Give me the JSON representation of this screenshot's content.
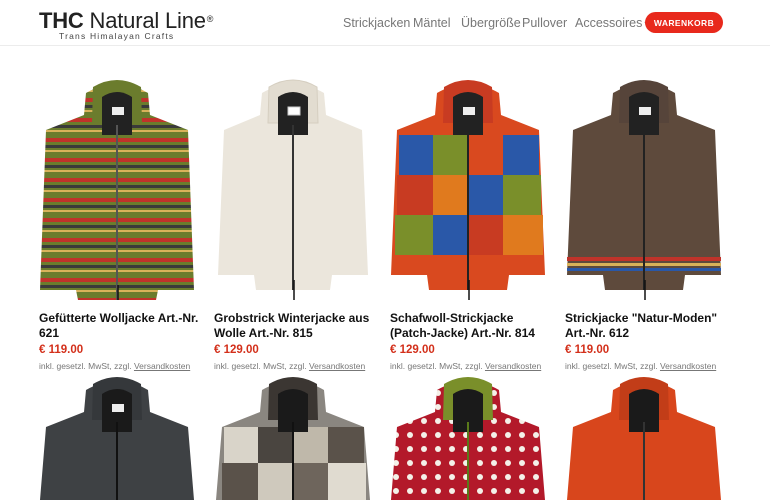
{
  "header": {
    "logo_bold": "THC",
    "logo_light": "Natural Line",
    "logo_reg": "®",
    "logo_tagline": "Trans Himalayan Crafts",
    "nav": [
      {
        "label": "Strickjacken"
      },
      {
        "label": "Mäntel"
      },
      {
        "label": "Übergröße"
      },
      {
        "label": "Pullover"
      },
      {
        "label": "Accessoires"
      }
    ],
    "cart_label": "WARENKORB"
  },
  "products": [
    {
      "title": "Gefütterte Wolljacke Art.-Nr. 621",
      "price": "€ 119.00",
      "tax_text": "inkl. gesetzl. MwSt, zzgl.",
      "shipping_link": "Versandkosten"
    },
    {
      "title": "Grobstrick Winterjacke aus Wolle Art.-Nr. 815",
      "price": "€ 129.00",
      "tax_text": "inkl. gesetzl. MwSt, zzgl.",
      "shipping_link": "Versandkosten"
    },
    {
      "title": "Schafwoll-Strickjacke (Patch-Jacke) Art.-Nr. 814",
      "price": "€ 129.00",
      "tax_text": "inkl. gesetzl. MwSt, zzgl.",
      "shipping_link": "Versandkosten"
    },
    {
      "title": "Strickjacke \"Natur-Moden\" Art.-Nr. 612",
      "price": "€ 119.00",
      "tax_text": "inkl. gesetzl. MwSt, zzgl.",
      "shipping_link": "Versandkosten"
    }
  ],
  "colors": {
    "accent": "#e8291c",
    "price": "#d32f1a"
  }
}
